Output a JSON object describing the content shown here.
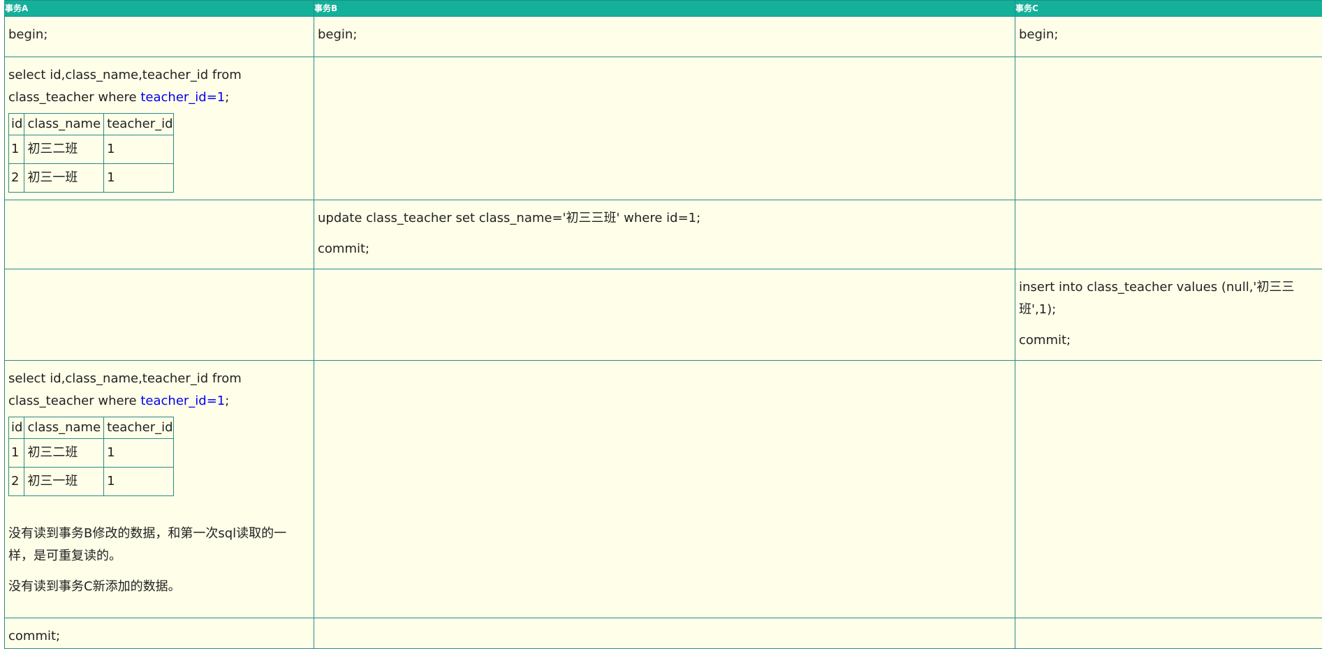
{
  "headers": {
    "a": "事务A",
    "b": "事务B",
    "c": "事务C"
  },
  "row1": {
    "a": "begin;",
    "b": "begin;",
    "c": "begin;"
  },
  "query": {
    "part1": "select id,class_name,teacher_id from class_teacher where ",
    "highlight": "teacher_id=1",
    "part2": ";"
  },
  "result_table": {
    "columns": [
      "id",
      "class_name",
      "teacher_id"
    ],
    "rows": [
      [
        "1",
        "初三二班",
        "1"
      ],
      [
        "2",
        "初三一班",
        "1"
      ]
    ]
  },
  "row3": {
    "b_update": "update class_teacher set class_name='初三三班' where id=1;",
    "b_commit": "commit;"
  },
  "row4": {
    "c_insert": "insert into class_teacher values (null,'初三三班',1);",
    "c_commit": "commit;"
  },
  "row5": {
    "note1": "没有读到事务B修改的数据，和第一次sql读取的一样，是可重复读的。",
    "note2": "没有读到事务C新添加的数据。"
  },
  "row6": {
    "a": "commit;"
  },
  "colors": {
    "header_bg": "#14b09a",
    "cell_bg": "#fefee9",
    "border": "#2a8a88",
    "highlight": "#0000ee"
  }
}
